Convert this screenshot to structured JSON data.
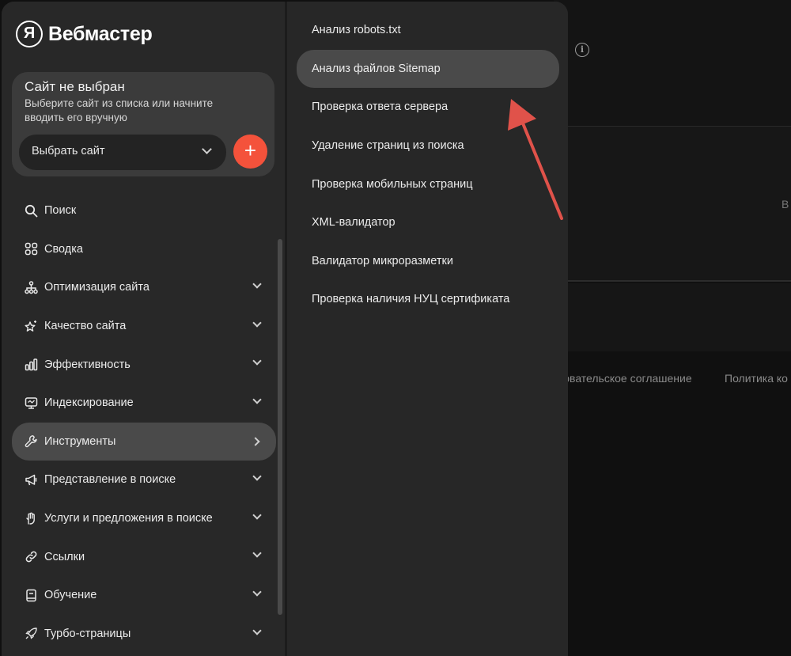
{
  "app": {
    "logo_mark": "Я",
    "logo_text": "Вебмастер"
  },
  "site_card": {
    "title": "Сайт не выбран",
    "description": "Выберите сайт из списка или начните вводить его вручную",
    "select_label": "Выбрать сайт",
    "add_label": "+"
  },
  "nav": {
    "items": [
      {
        "label": "Поиск",
        "icon": "search-icon",
        "chevron": "none"
      },
      {
        "label": "Сводка",
        "icon": "grid-icon",
        "chevron": "none"
      },
      {
        "label": "Оптимизация сайта",
        "icon": "sitemap-icon",
        "chevron": "down"
      },
      {
        "label": "Качество сайта",
        "icon": "star-sparkle-icon",
        "chevron": "down"
      },
      {
        "label": "Эффективность",
        "icon": "bar-chart-icon",
        "chevron": "down"
      },
      {
        "label": "Индексирование",
        "icon": "monitor-icon",
        "chevron": "down"
      },
      {
        "label": "Инструменты",
        "icon": "wrench-icon",
        "chevron": "right",
        "active": true
      },
      {
        "label": "Представление в поиске",
        "icon": "megaphone-icon",
        "chevron": "down"
      },
      {
        "label": "Услуги и предложения в поиске",
        "icon": "hand-icon",
        "chevron": "down"
      },
      {
        "label": "Ссылки",
        "icon": "link-icon",
        "chevron": "down"
      },
      {
        "label": "Обучение",
        "icon": "book-icon",
        "chevron": "down"
      },
      {
        "label": "Турбо-страницы",
        "icon": "rocket-icon",
        "chevron": "down"
      }
    ]
  },
  "submenu": {
    "items": [
      {
        "label": "Анализ robots.txt"
      },
      {
        "label": "Анализ файлов Sitemap",
        "active": true
      },
      {
        "label": "Проверка ответа сервера"
      },
      {
        "label": "Удаление страниц из поиска"
      },
      {
        "label": "Проверка мобильных страниц"
      },
      {
        "label": "XML-валидатор"
      },
      {
        "label": "Валидатор микроразметки"
      },
      {
        "label": "Проверка наличия НУЦ сертификата"
      }
    ]
  },
  "background": {
    "info_icon": "i",
    "partial_letter": "В",
    "footer_links": [
      "зовательское соглашение",
      "Политика ко"
    ]
  },
  "colors": {
    "accent": "#f4523b",
    "annotation_arrow": "#e0524a",
    "panel": "#282828",
    "active": "#4a4a4a"
  }
}
